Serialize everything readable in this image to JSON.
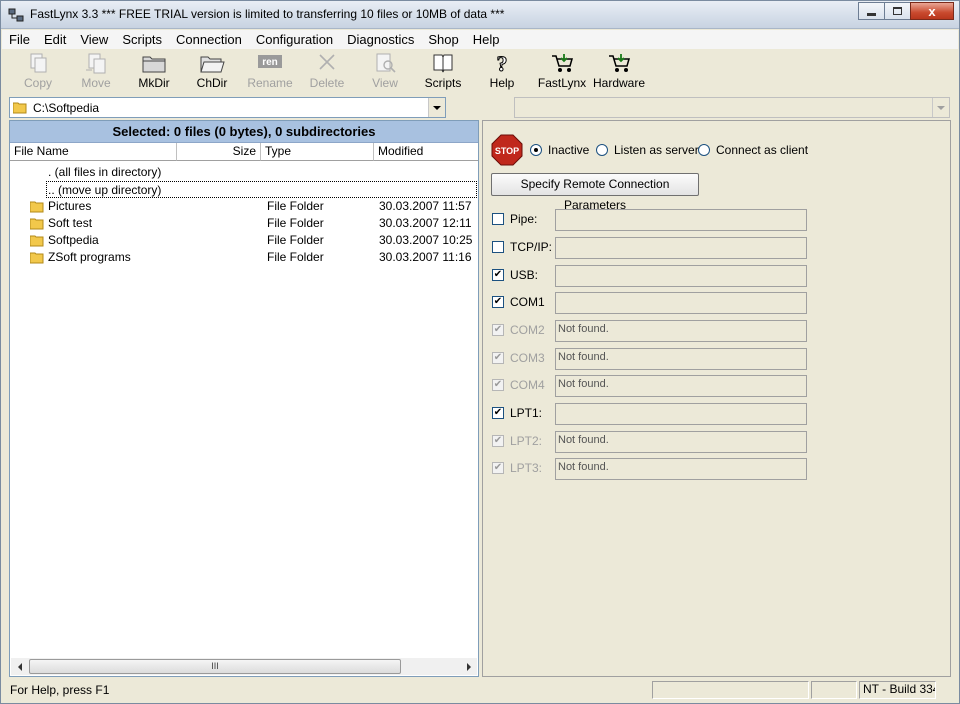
{
  "window": {
    "title": "FastLynx 3.3  *** FREE TRIAL version is limited to transferring 10 files or 10MB of data ***",
    "close_glyph": "x"
  },
  "menu": [
    "File",
    "Edit",
    "View",
    "Scripts",
    "Connection",
    "Configuration",
    "Diagnostics",
    "Shop",
    "Help"
  ],
  "toolbar": {
    "copy": "Copy",
    "move": "Move",
    "mkdir": "MkDir",
    "chdir": "ChDir",
    "rename": "Rename",
    "rename_icon_text": "ren",
    "delete": "Delete",
    "view": "View",
    "scripts": "Scripts",
    "help": "Help",
    "fastlynx": "FastLynx",
    "hardware": "Hardware"
  },
  "path": {
    "current": "C:\\Softpedia"
  },
  "file_list": {
    "selection_summary": "Selected: 0 files (0 bytes),  0 subdirectories",
    "columns": [
      "File Name",
      "Size",
      "Type",
      "Modified"
    ],
    "special_rows": [
      ". (all files in directory)",
      ".. (move up directory)"
    ],
    "rows": [
      {
        "name": "Pictures",
        "size": "",
        "type": "File Folder",
        "modified": "30.03.2007 11:57"
      },
      {
        "name": "Soft test",
        "size": "",
        "type": "File Folder",
        "modified": "30.03.2007 12:11"
      },
      {
        "name": "Softpedia",
        "size": "",
        "type": "File Folder",
        "modified": "30.03.2007 10:25"
      },
      {
        "name": "ZSoft programs",
        "size": "",
        "type": "File Folder",
        "modified": "30.03.2007 11:16"
      }
    ],
    "scroll_grip": "III"
  },
  "connection": {
    "stop_label": "STOP",
    "modes": [
      "Inactive",
      "Listen as server",
      "Connect as client"
    ],
    "selected_mode": "Inactive",
    "remote_button": "Specify Remote Connection Parameters",
    "ports": [
      {
        "label": "Pipe:",
        "checked": false,
        "enabled": true,
        "status": ""
      },
      {
        "label": "TCP/IP:",
        "checked": false,
        "enabled": true,
        "status": ""
      },
      {
        "label": "USB:",
        "checked": true,
        "enabled": true,
        "status": ""
      },
      {
        "label": "COM1",
        "checked": true,
        "enabled": true,
        "status": ""
      },
      {
        "label": "COM2",
        "checked": true,
        "enabled": false,
        "status": "Not found."
      },
      {
        "label": "COM3",
        "checked": true,
        "enabled": false,
        "status": "Not found."
      },
      {
        "label": "COM4",
        "checked": true,
        "enabled": false,
        "status": "Not found."
      },
      {
        "label": "LPT1:",
        "checked": true,
        "enabled": true,
        "status": ""
      },
      {
        "label": "LPT2:",
        "checked": true,
        "enabled": false,
        "status": "Not found."
      },
      {
        "label": "LPT3:",
        "checked": true,
        "enabled": false,
        "status": "Not found."
      }
    ]
  },
  "status": {
    "help_text": "For Help, press F1",
    "build": "NT - Build 334"
  }
}
